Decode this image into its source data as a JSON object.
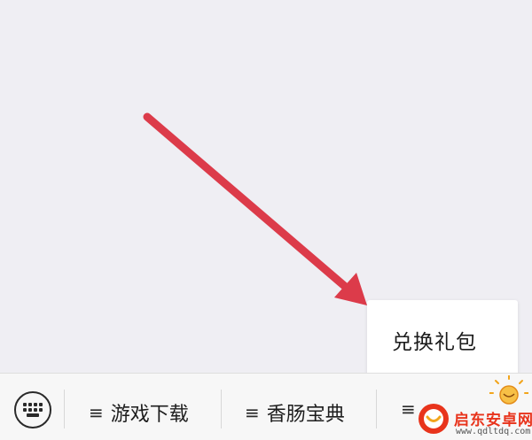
{
  "popup_menu": {
    "item_label": "兑换礼包"
  },
  "bottom_bar": {
    "menus": [
      {
        "glyph": "≡",
        "label": "游戏下载"
      },
      {
        "glyph": "≡",
        "label": "香肠宝典"
      },
      {
        "glyph": "≡",
        "label": ""
      }
    ]
  },
  "watermark": {
    "title": "启东安卓网",
    "url": "www.qdltdq.com"
  },
  "colors": {
    "arrow": "#dc3b4a",
    "background": "#efeef3",
    "watermark_red": "#e8341c"
  }
}
